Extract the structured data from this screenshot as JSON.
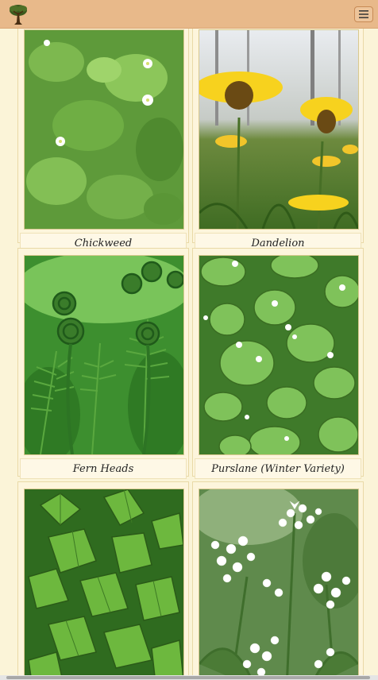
{
  "navbar": {
    "logo_icon": "tree-logo-icon",
    "menu_icon": "hamburger-menu-icon",
    "background_color": "#e8b98a"
  },
  "plants": [
    {
      "caption": "Chickweed",
      "photo_icon": "chickweed-photo"
    },
    {
      "caption": "Dandelion",
      "photo_icon": "dandelion-photo"
    },
    {
      "caption": "Fern Heads",
      "photo_icon": "fern-heads-photo"
    },
    {
      "caption": "Purslane (Winter Variety)",
      "photo_icon": "purslane-photo"
    },
    {
      "caption": "",
      "photo_icon": "nettle-photo"
    },
    {
      "caption": "",
      "photo_icon": "wild-garlic-photo"
    }
  ]
}
